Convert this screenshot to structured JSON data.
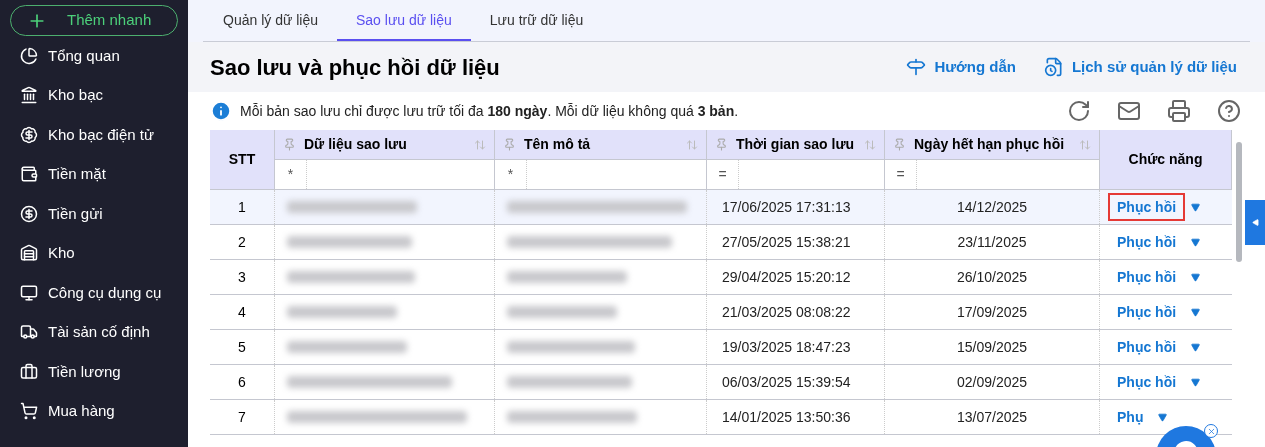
{
  "sidebar": {
    "quick_add": "Thêm nhanh",
    "items": [
      {
        "label": "Tổng quan"
      },
      {
        "label": "Kho bạc"
      },
      {
        "label": "Kho bạc điện tử"
      },
      {
        "label": "Tiền mặt"
      },
      {
        "label": "Tiền gửi"
      },
      {
        "label": "Kho"
      },
      {
        "label": "Công cụ dụng cụ"
      },
      {
        "label": "Tài sản cố định"
      },
      {
        "label": "Tiền lương"
      },
      {
        "label": "Mua hàng"
      }
    ]
  },
  "tabs": [
    {
      "label": "Quản lý dữ liệu",
      "selected": false
    },
    {
      "label": "Sao lưu dữ liệu",
      "selected": true
    },
    {
      "label": "Lưu trữ dữ liệu",
      "selected": false
    }
  ],
  "page_title": "Sao lưu và phục hồi dữ liệu",
  "header_links": [
    {
      "label": "Hướng dẫn"
    },
    {
      "label": "Lịch sử quản lý dữ liệu"
    }
  ],
  "notice": "Mỗi bản sao lưu chỉ được lưu trữ tối đa **180 ngày**. Mỗi dữ liệu không quá **3 bản**.",
  "table": {
    "columns": [
      {
        "label": "STT"
      },
      {
        "label": "Dữ liệu sao lưu",
        "filter": "*"
      },
      {
        "label": "Tên mô tả",
        "filter": "*"
      },
      {
        "label": "Thời gian sao lưu",
        "filter": "="
      },
      {
        "label": "Ngày hết hạn phục hồi",
        "filter": "="
      },
      {
        "label": "Chức năng"
      }
    ],
    "rows": [
      {
        "stt": "1",
        "backup_time": "17/06/2025 17:31:13",
        "expiry": "14/12/2025",
        "action": "Phục hồi",
        "selected": true
      },
      {
        "stt": "2",
        "backup_time": "27/05/2025 15:38:21",
        "expiry": "23/11/2025",
        "action": "Phục hồi",
        "selected": false
      },
      {
        "stt": "3",
        "backup_time": "29/04/2025 15:20:12",
        "expiry": "26/10/2025",
        "action": "Phục hồi",
        "selected": false
      },
      {
        "stt": "4",
        "backup_time": "21/03/2025 08:08:22",
        "expiry": "17/09/2025",
        "action": "Phục hồi",
        "selected": false
      },
      {
        "stt": "5",
        "backup_time": "19/03/2025 18:47:23",
        "expiry": "15/09/2025",
        "action": "Phục hồi",
        "selected": false
      },
      {
        "stt": "6",
        "backup_time": "06/03/2025 15:39:54",
        "expiry": "02/09/2025",
        "action": "Phục hồi",
        "selected": false
      },
      {
        "stt": "7",
        "backup_time": "14/01/2025 13:50:36",
        "expiry": "13/07/2025",
        "action": "Phụ",
        "selected": false
      }
    ]
  }
}
